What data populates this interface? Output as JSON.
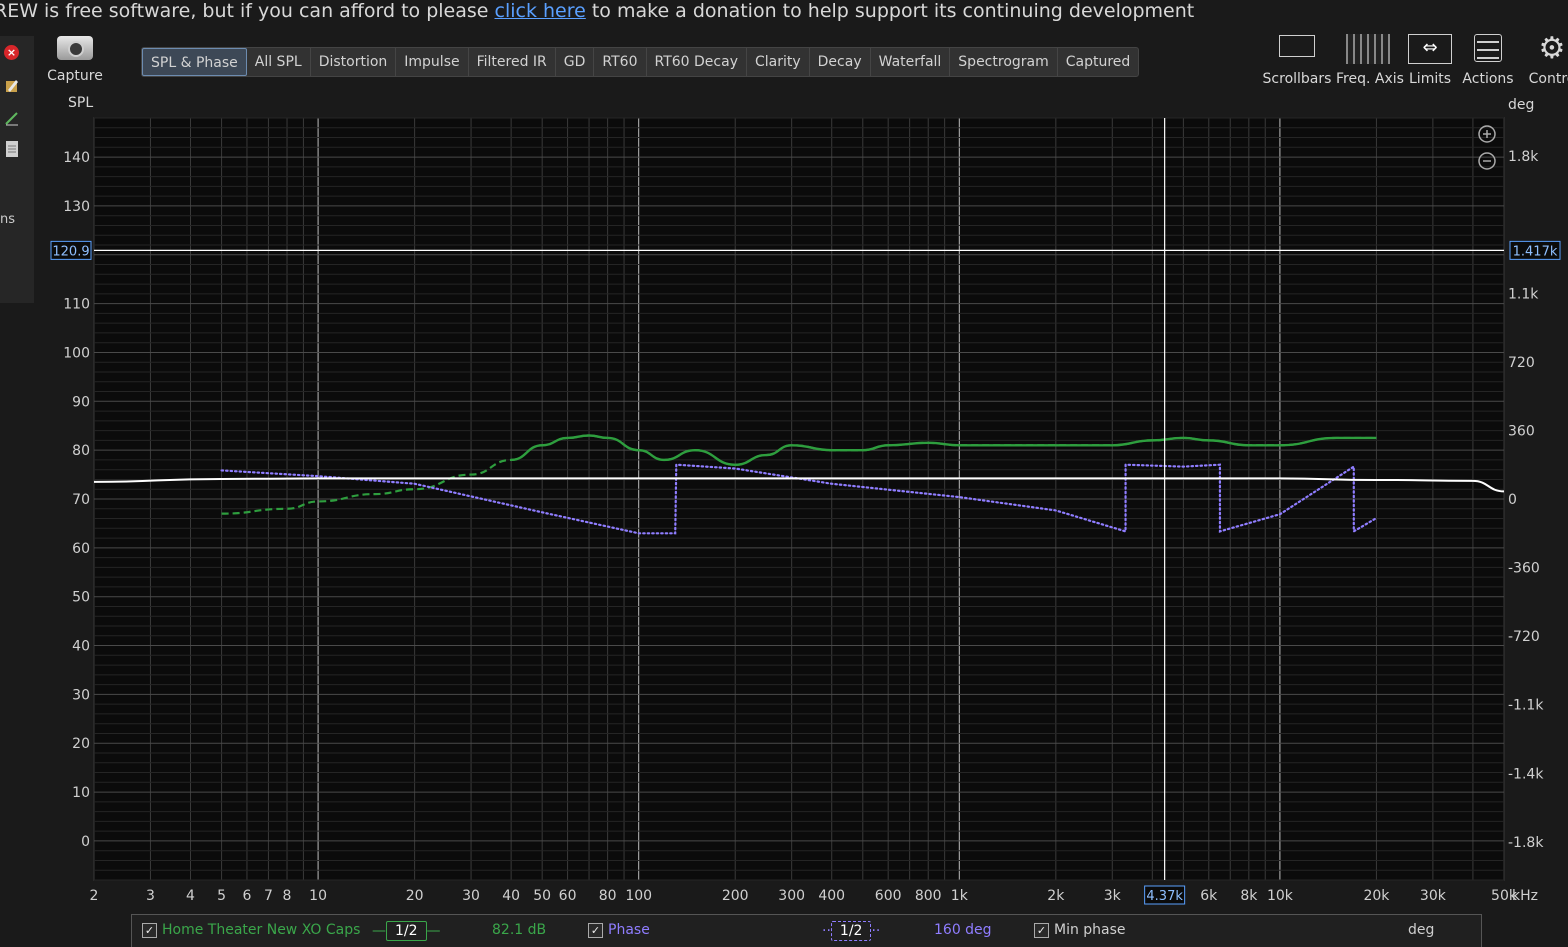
{
  "banner": {
    "prefix": "REW is free software, but if you can afford to please ",
    "link": "click here",
    "suffix": " to make a donation to help support its continuing development"
  },
  "left_panel": {
    "partial_label": "ns"
  },
  "capture": {
    "label": "Capture"
  },
  "tabs": [
    {
      "label": "SPL & Phase",
      "active": true
    },
    {
      "label": "All SPL"
    },
    {
      "label": "Distortion"
    },
    {
      "label": "Impulse"
    },
    {
      "label": "Filtered IR"
    },
    {
      "label": "GD"
    },
    {
      "label": "RT60"
    },
    {
      "label": "RT60 Decay"
    },
    {
      "label": "Clarity"
    },
    {
      "label": "Decay"
    },
    {
      "label": "Waterfall"
    },
    {
      "label": "Spectrogram"
    },
    {
      "label": "Captured"
    }
  ],
  "tools": {
    "scrollbars": "Scrollbars",
    "freq_axis": "Freq. Axis",
    "limits": "Limits",
    "actions": "Actions",
    "controls": "Contro"
  },
  "icons": {
    "close": "close-icon",
    "edit": "edit-icon",
    "pen": "pen-icon",
    "doc": "document-icon",
    "camera": "camera-icon",
    "zoom_in": "zoom-in-icon",
    "zoom_out": "zoom-out-icon",
    "gear": "gear-icon"
  },
  "colors": {
    "spl": "#2e9e3e",
    "phase": "#8f7dff",
    "min_phase": "#ffffff",
    "cursor": "#ffffff",
    "highlight": "#5aa0ff"
  },
  "chart_data": {
    "type": "line",
    "x_scale": "log",
    "xlim": [
      2,
      50000
    ],
    "ylim": [
      -8,
      148
    ],
    "y2lim": [
      -2000,
      2000
    ],
    "ylabel": "SPL",
    "y2label": "deg",
    "xunit": "kHz",
    "x_ticks": [
      {
        "v": 2,
        "l": "2"
      },
      {
        "v": 3,
        "l": "3"
      },
      {
        "v": 4,
        "l": "4"
      },
      {
        "v": 5,
        "l": "5"
      },
      {
        "v": 6,
        "l": "6"
      },
      {
        "v": 7,
        "l": "7"
      },
      {
        "v": 8,
        "l": "8"
      },
      {
        "v": 10,
        "l": "10"
      },
      {
        "v": 20,
        "l": "20"
      },
      {
        "v": 30,
        "l": "30"
      },
      {
        "v": 40,
        "l": "40"
      },
      {
        "v": 50,
        "l": "50"
      },
      {
        "v": 60,
        "l": "60"
      },
      {
        "v": 80,
        "l": "80"
      },
      {
        "v": 100,
        "l": "100"
      },
      {
        "v": 200,
        "l": "200"
      },
      {
        "v": 300,
        "l": "300"
      },
      {
        "v": 400,
        "l": "400"
      },
      {
        "v": 600,
        "l": "600"
      },
      {
        "v": 800,
        "l": "800"
      },
      {
        "v": 1000,
        "l": "1k"
      },
      {
        "v": 2000,
        "l": "2k"
      },
      {
        "v": 3000,
        "l": "3k"
      },
      {
        "v": 6000,
        "l": "6k"
      },
      {
        "v": 8000,
        "l": "8k"
      },
      {
        "v": 10000,
        "l": "10k"
      },
      {
        "v": 20000,
        "l": "20k"
      },
      {
        "v": 30000,
        "l": "30k"
      },
      {
        "v": 50000,
        "l": "50k"
      }
    ],
    "y_ticks": [
      0,
      10,
      20,
      30,
      40,
      50,
      60,
      70,
      80,
      90,
      100,
      110,
      130,
      140
    ],
    "y2_ticks": [
      {
        "v": -1800,
        "l": "-1.8k"
      },
      {
        "v": -1440,
        "l": "-1.4k"
      },
      {
        "v": -1080,
        "l": "-1.1k"
      },
      {
        "v": -720,
        "l": "-720"
      },
      {
        "v": -360,
        "l": "-360"
      },
      {
        "v": 0,
        "l": "0"
      },
      {
        "v": 360,
        "l": "360"
      },
      {
        "v": 720,
        "l": "720"
      },
      {
        "v": 1080,
        "l": "1.1k"
      },
      {
        "v": 1800,
        "l": "1.8k"
      }
    ],
    "cursor": {
      "x": 4370,
      "x_label": "4.37k",
      "y": 120.9,
      "y_label": "120.9",
      "y2_label": "1.417k"
    },
    "series": [
      {
        "name": "Home Theater New XO Caps",
        "axis": "left",
        "style": "solid-dashed",
        "x": [
          5,
          8,
          10,
          15,
          20,
          30,
          40,
          50,
          60,
          70,
          80,
          100,
          120,
          150,
          200,
          250,
          300,
          400,
          500,
          600,
          800,
          1000,
          1500,
          2000,
          3000,
          4000,
          5000,
          6000,
          8000,
          10000,
          15000,
          20000
        ],
        "y": [
          67,
          68,
          69.5,
          71,
          72,
          75,
          78,
          81,
          82.5,
          83,
          82.5,
          80,
          78,
          80,
          77,
          79,
          81,
          80,
          80,
          81,
          81.5,
          81,
          81,
          81,
          81,
          82,
          82.5,
          82,
          81,
          81,
          82.5,
          82.5
        ]
      },
      {
        "name": "Phase",
        "axis": "right",
        "style": "dotted",
        "x": [
          5,
          10,
          20,
          50,
          100,
          130,
          131,
          200,
          400,
          1000,
          2000,
          3300,
          3301,
          5000,
          6500,
          6501,
          10000,
          17000,
          17001,
          20000
        ],
        "y": [
          150,
          120,
          80,
          -70,
          -180,
          -180,
          180,
          160,
          80,
          10,
          -60,
          -170,
          180,
          170,
          180,
          -170,
          -80,
          170,
          -170,
          -100
        ]
      },
      {
        "name": "Min phase",
        "axis": "right",
        "style": "solid",
        "x": [
          2,
          5,
          10,
          100,
          1000,
          10000,
          20000,
          40000,
          50000
        ],
        "y": [
          90,
          105,
          108,
          108,
          108,
          108,
          100,
          95,
          40
        ]
      }
    ]
  },
  "legend": {
    "name": "Home Theater New XO Caps",
    "smoothing1": "1/2",
    "value1": "82.1 dB",
    "phase": "Phase",
    "smoothing2": "1/2",
    "value2": "160 deg",
    "min_phase": "Min phase",
    "deg": "deg"
  }
}
